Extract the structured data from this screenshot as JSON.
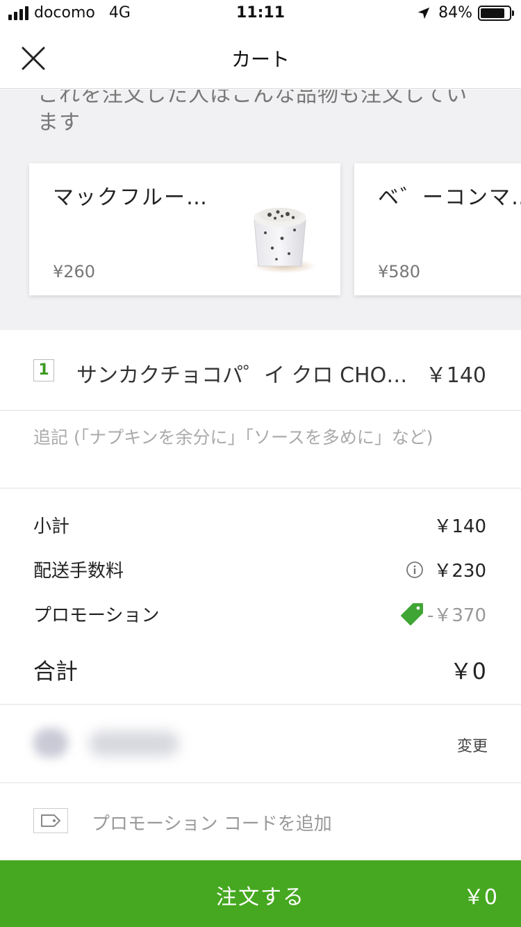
{
  "status_bar": {
    "carrier": "docomo",
    "network": "4G",
    "time": "11:11",
    "battery": "84%",
    "battery_level": 0.84
  },
  "nav": {
    "title": "カート"
  },
  "suggestions": {
    "heading": "これを注文した人はこんな品物も注文しています",
    "items": [
      {
        "name": "マックフルー…",
        "price": "¥260"
      },
      {
        "name": "ベ゛ーコンマ…",
        "price": "¥580"
      }
    ]
  },
  "cart_item": {
    "quantity": "1",
    "name": "サンカクチョコパ゜イ クロ CHOCO",
    "price": "￥140"
  },
  "note": {
    "placeholder": "追記 (「ナプキンを余分に」「ソースを多めに」など)"
  },
  "summary": {
    "subtotal_label": "小計",
    "subtotal": "￥140",
    "delivery_label": "配送手数料",
    "delivery": "￥230",
    "promotion_label": "プロモーション",
    "promotion": "-￥370",
    "total_label": "合計",
    "total": "￥0"
  },
  "address": {
    "change_label": "変更"
  },
  "promo_code": {
    "label": "プロモーション コードを追加"
  },
  "order_button": {
    "label": "注文する",
    "price": "￥0"
  },
  "colors": {
    "brand_green": "#46a820",
    "tag_green": "#3fa535"
  }
}
